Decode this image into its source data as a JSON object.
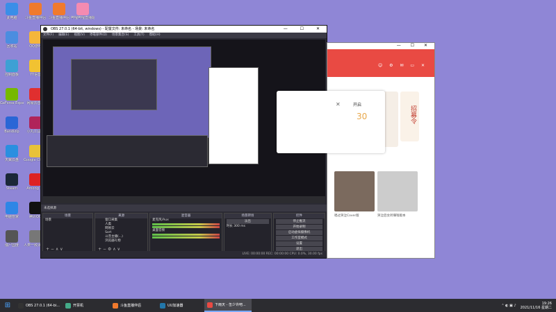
{
  "desktop_icons": [
    {
      "label": "此电脑",
      "color": "#3a8ee8"
    },
    {
      "label": "斗鱼直播伴侣",
      "color": "#f07a2d"
    },
    {
      "label": "斗鱼直播伴侣",
      "color": "#f07a2d"
    },
    {
      "label": "哔哩哔哩直播姬",
      "color": "#f48bb1"
    },
    {
      "label": "回收站",
      "color": "#4b8de0"
    },
    {
      "label": "QQ游戏",
      "color": "#f5b63a"
    },
    {
      "label": "控制面板",
      "color": "#3da0d4"
    },
    {
      "label": "YY语音",
      "color": "#f1c232"
    },
    {
      "label": "GeForce Experience",
      "color": "#76b900"
    },
    {
      "label": "网易云音乐",
      "color": "#e02f2f"
    },
    {
      "label": "Bandizip",
      "color": "#2a66d6"
    },
    {
      "label": "小丸工具箱",
      "color": "#b0245a"
    },
    {
      "label": "天翼云盘",
      "color": "#2a8fe0"
    },
    {
      "label": "Google Chrome",
      "color": "#e8c23a"
    },
    {
      "label": "Steam",
      "color": "#1b2838"
    },
    {
      "label": "Among Us",
      "color": "#d22"
    },
    {
      "label": "电脑管家",
      "color": "#2e86e6"
    },
    {
      "label": "腾讯QQ",
      "color": "#111"
    },
    {
      "label": "僵尸国度",
      "color": "#555"
    },
    {
      "label": "人类一败涂地 Human Fall Flat",
      "color": "#777"
    }
  ],
  "obs": {
    "title": "OBS 27.0.1 (64-bit, windows) - 配置文件: 未命名 - 场景: 未命名",
    "menu": [
      "文件(F)",
      "编辑(E)",
      "视图(V)",
      "停靠部件(D)",
      "场景集合(S)",
      "工具(T)",
      "帮助(H)"
    ],
    "mid_bar": "未选择源",
    "docks": {
      "scenes": {
        "header": "场景",
        "items": [
          "场景"
        ]
      },
      "sources": {
        "header": "来源",
        "items": [
          "窗口采集",
          "人类",
          "网易云",
          "Sort",
          "斗音主播(...)",
          "浏览器礼物"
        ]
      },
      "mixer": {
        "header": "混音器",
        "items": [
          "麦克风/Aux",
          "桌面音频"
        ]
      },
      "transitions": {
        "header": "场景转场",
        "fade": "淡出",
        "duration_label": "时长",
        "duration": "300 ms"
      },
      "controls": {
        "header": "控件",
        "buttons": [
          "停止推流",
          "开始录制",
          "启动虚拟摄像机",
          "工作室模式",
          "设置",
          "退出"
        ]
      }
    },
    "status": "LIVE: 00:00:00   REC: 00:00:00   CPU: 0.0%, 30.00 fps"
  },
  "app": {
    "popup_title": "开启",
    "popup_number": "30",
    "banner_text": "招募令",
    "tag": "数字专辑",
    "caption_left": "唱过哭泣Cover版",
    "caption_right": "哭泣后女听赚钱版本"
  },
  "taskbar": {
    "items": [
      {
        "label": "OBS 27.0.1 (64-bi...",
        "color": "#333"
      },
      {
        "label": "开票机",
        "color": "#4a8"
      },
      {
        "label": "斗鱼直播伴侣",
        "color": "#f07a2d"
      },
      {
        "label": "UU加速器",
        "color": "#27a"
      },
      {
        "label": "下雨天 - 缶少许吧...",
        "color": "#e94a43"
      }
    ],
    "time": "19:26",
    "date": "2021/11/16 星期二"
  }
}
